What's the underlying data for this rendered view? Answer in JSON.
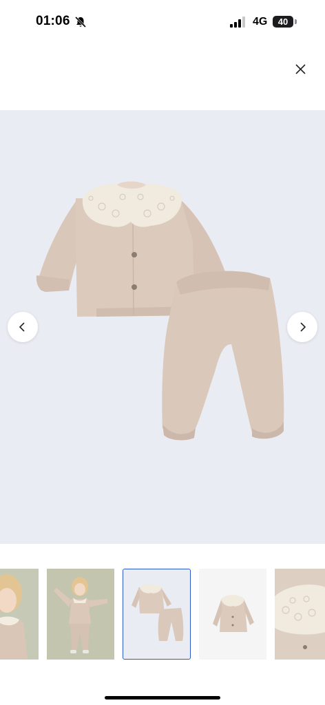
{
  "status_bar": {
    "time": "01:06",
    "network": "4G",
    "battery": "40",
    "icons": [
      "bell-muted-icon",
      "signal-icon"
    ]
  },
  "toolbar": {
    "close_icon": "close-icon"
  },
  "gallery": {
    "nav_icons": [
      "chevron-left-icon",
      "chevron-right-icon"
    ],
    "selected_index": 2,
    "thumbnail_count": 5
  },
  "colors": {
    "hero_background": "#eaecf3",
    "garment": "#d9c7b9",
    "collar": "#f1ebdf",
    "selected_border": "#2a57c9"
  }
}
